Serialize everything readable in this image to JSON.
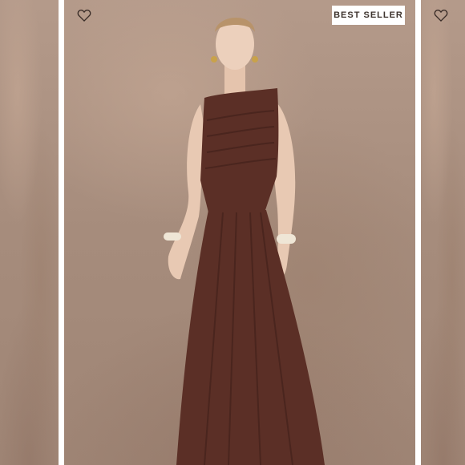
{
  "badge": {
    "label": "BEST SELLER"
  },
  "icons": {
    "wishlist_left": "heart-outline-icon",
    "wishlist_right": "heart-outline-icon"
  },
  "colors": {
    "backdrop": "#a68c7c",
    "dress": "#5b2f26",
    "badge_bg": "#ffffff",
    "badge_text": "#3c322c"
  }
}
